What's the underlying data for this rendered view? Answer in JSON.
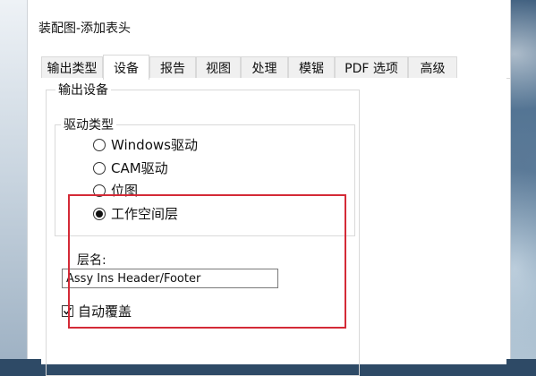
{
  "window": {
    "title": "装配图-添加表头"
  },
  "tabs": [
    {
      "label": "输出类型",
      "active": false
    },
    {
      "label": "设备",
      "active": true
    },
    {
      "label": "报告",
      "active": false
    },
    {
      "label": "视图",
      "active": false
    },
    {
      "label": "处理",
      "active": false
    },
    {
      "label": "模锯",
      "active": false
    },
    {
      "label": "PDF 选项",
      "active": false
    },
    {
      "label": "高级",
      "active": false
    }
  ],
  "output_device": {
    "group_label": "输出设备",
    "driver_group_label": "驱动类型",
    "drivers": [
      {
        "label": "Windows驱动",
        "selected": false
      },
      {
        "label": "CAM驱动",
        "selected": false
      },
      {
        "label": "位图",
        "selected": false
      },
      {
        "label": "工作空间层",
        "selected": true
      }
    ],
    "layer_name_label": "层名:",
    "layer_name_value": "Assy Ins Header/Footer",
    "auto_overwrite_label": "自动覆盖",
    "auto_overwrite_checked": true
  },
  "colors": {
    "highlight": "#d42a37"
  }
}
